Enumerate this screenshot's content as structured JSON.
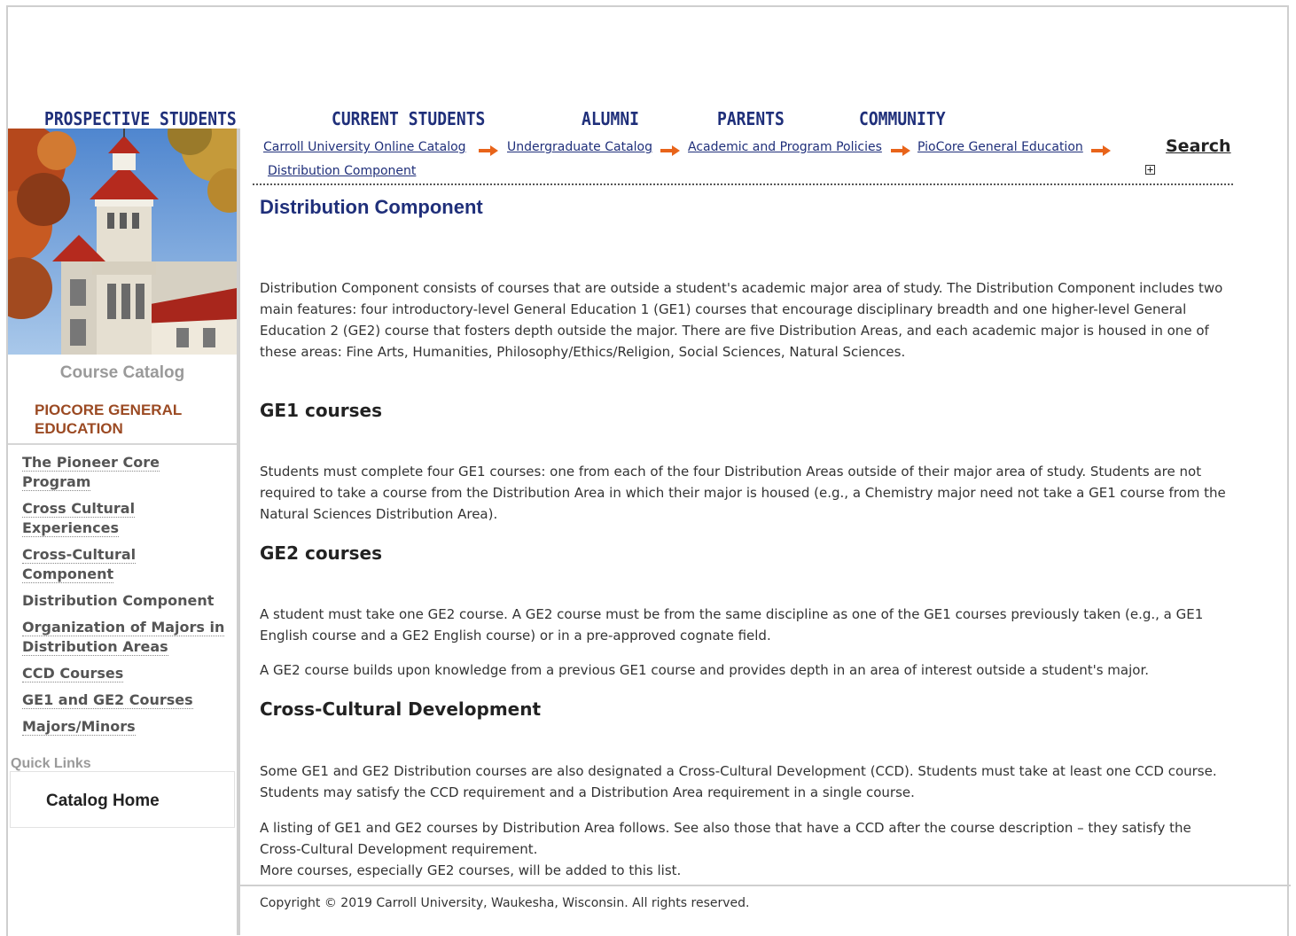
{
  "topnav": {
    "items": [
      {
        "label": "PROSPECTIVE STUDENTS"
      },
      {
        "label": "CURRENT STUDENTS"
      },
      {
        "label": "ALUMNI"
      },
      {
        "label": "PARENTS"
      },
      {
        "label": "COMMUNITY"
      }
    ]
  },
  "sidebar": {
    "catalog_label": "Course Catalog",
    "section_label": "PIOCORE GENERAL EDUCATION",
    "items": [
      {
        "label": "The Pioneer Core Program"
      },
      {
        "label": "Cross Cultural Experiences"
      },
      {
        "label": "Cross-Cultural Component"
      },
      {
        "label": "Distribution Component"
      },
      {
        "label": "Organization of Majors in Distribution Areas"
      },
      {
        "label": "CCD Courses"
      },
      {
        "label": "GE1 and GE2 Courses"
      },
      {
        "label": "Majors/Minors"
      }
    ],
    "quick_links_title": "Quick Links",
    "quick_links": [
      {
        "label": "Catalog Home"
      }
    ]
  },
  "breadcrumb": {
    "items": [
      {
        "label": "Carroll University Online Catalog "
      },
      {
        "label": "Undergraduate Catalog"
      },
      {
        "label": "Academic and Program Policies"
      },
      {
        "label": "PioCore General Education"
      },
      {
        "label": "Distribution Component"
      }
    ]
  },
  "search": {
    "label": "Search"
  },
  "colors": {
    "nav_blue": "#1f2f7a",
    "accent_orange": "#e8641a",
    "section_brown": "#9b4a23"
  },
  "content": {
    "title": "Distribution Component",
    "intro": "Distribution Component consists of courses that are outside a student's academic major area of study. The Distribution Component includes two main features: four introductory-level General Education 1 (GE1) courses  that  encourage disciplinary breadth and one higher-level General Education 2 (GE2) course that fosters depth outside the major. There are five Distribution Areas, and each academic major is housed in one of these areas:  Fine Arts, Humanities, Philosophy/Ethics/Religion, Social Sciences, Natural Sciences.",
    "ge1_heading": "GE1 courses",
    "ge1_text": "Students must complete four GE1 courses: one from each of the four Distribution Areas outside of their major area of study. Students are not required to take a course from the Distribution Area in which their major is housed (e.g., a Chemistry major need not take a GE1 course from the Natural Sciences Distribution Area).",
    "ge2_heading": "GE2 courses",
    "ge2_text_1": "A student must take one GE2 course. A GE2 course must be from the same discipline as one of the GE1 courses previously taken (e.g., a GE1 English course and a GE2 English course) or in a pre-approved cognate field.",
    "ge2_text_2": "A GE2 course builds upon knowledge from a previous GE1 course and provides depth in an area of interest outside a student's major.",
    "ccd_heading": "Cross-Cultural Development",
    "ccd_text_1": "Some GE1 and GE2 Distribution courses are also designated a Cross-Cultural Development (CCD). Students must take at least one CCD course. Students may satisfy the CCD requirement and a Distribution Area requirement in a single course.",
    "ccd_text_2": "A listing of GE1 and GE2 courses by Distribution Area follows. See also those that have a CCD after the course description  – they satisfy the Cross-Cultural Development requirement.",
    "ccd_text_3": "More courses, especially GE2 courses, will be added to this list."
  },
  "footer": {
    "copyright": "Copyright © 2019 Carroll University, Waukesha, Wisconsin. All rights reserved."
  }
}
